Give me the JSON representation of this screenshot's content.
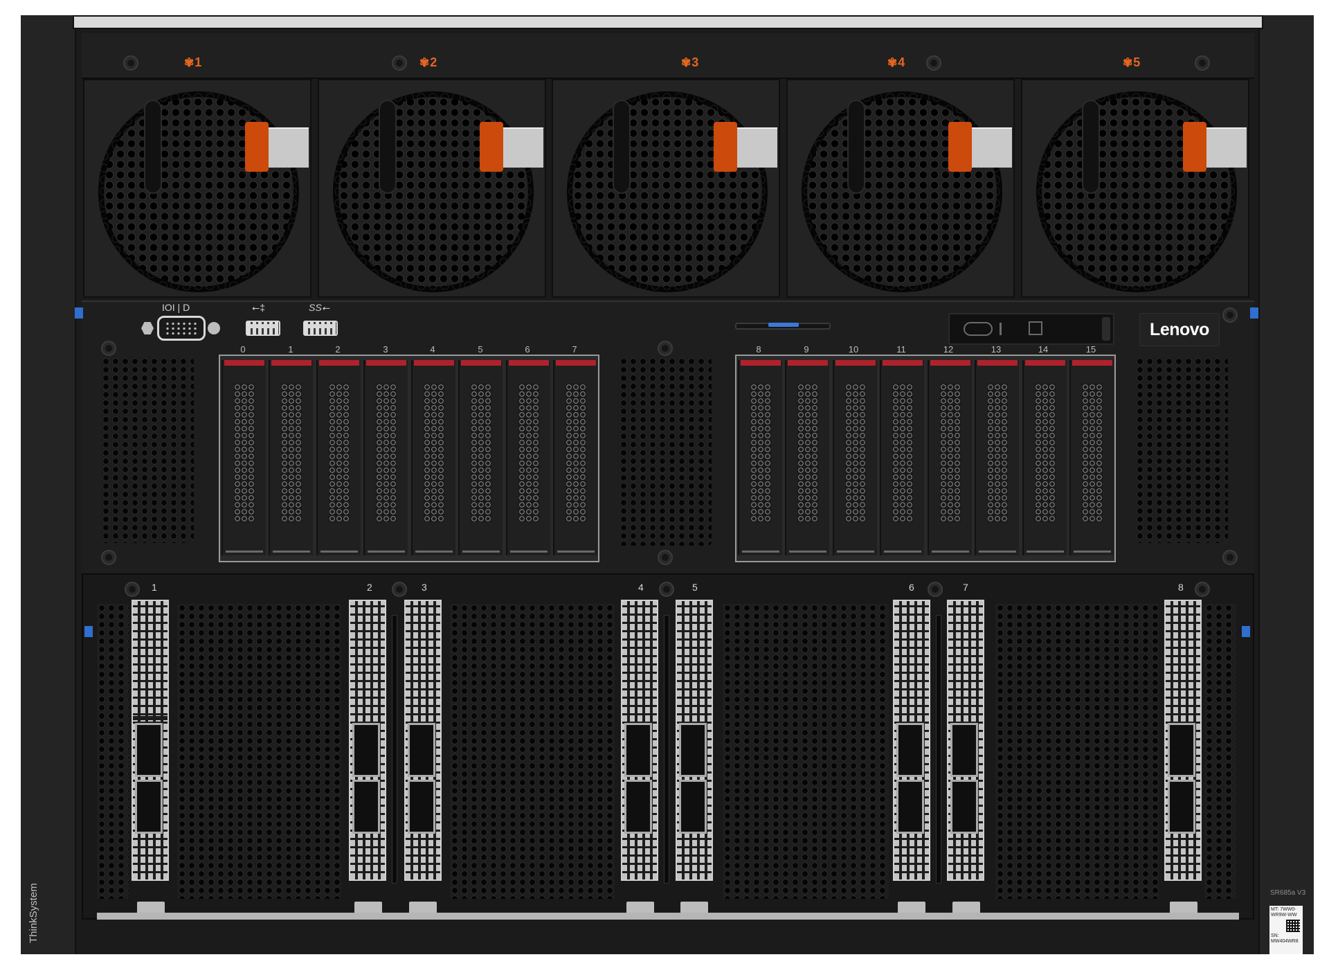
{
  "fans": {
    "items": [
      {
        "label": "1",
        "glyph": "✾"
      },
      {
        "label": "2",
        "glyph": "✾"
      },
      {
        "label": "3",
        "glyph": "✾"
      },
      {
        "label": "4",
        "glyph": "✾"
      },
      {
        "label": "5",
        "glyph": "✾"
      }
    ],
    "accent_color": "#e5661f",
    "latch_color": "#cc4a0c"
  },
  "front_io": {
    "vga_icon_text": "IOI | D",
    "usb2_icon": "usb-icon",
    "usb3_icon_text": "SS",
    "brand_logo": "Lenovo"
  },
  "drive_bays": {
    "left": [
      "0",
      "1",
      "2",
      "3",
      "4",
      "5",
      "6",
      "7"
    ],
    "right": [
      "8",
      "9",
      "10",
      "11",
      "12",
      "13",
      "14",
      "15"
    ],
    "tab_color": "#b2212b"
  },
  "pcie_slots": {
    "labels": [
      "1",
      "2",
      "3",
      "4",
      "5",
      "6",
      "7",
      "8"
    ]
  },
  "chassis": {
    "series_text": "ThinkSystem",
    "model_text": "SR685a V3",
    "sticker_mt": "MT: 7WW0- WR9W-WW",
    "sticker_sn": "SN: MW404WR8",
    "release_tab_color": "#2f6fd0"
  }
}
